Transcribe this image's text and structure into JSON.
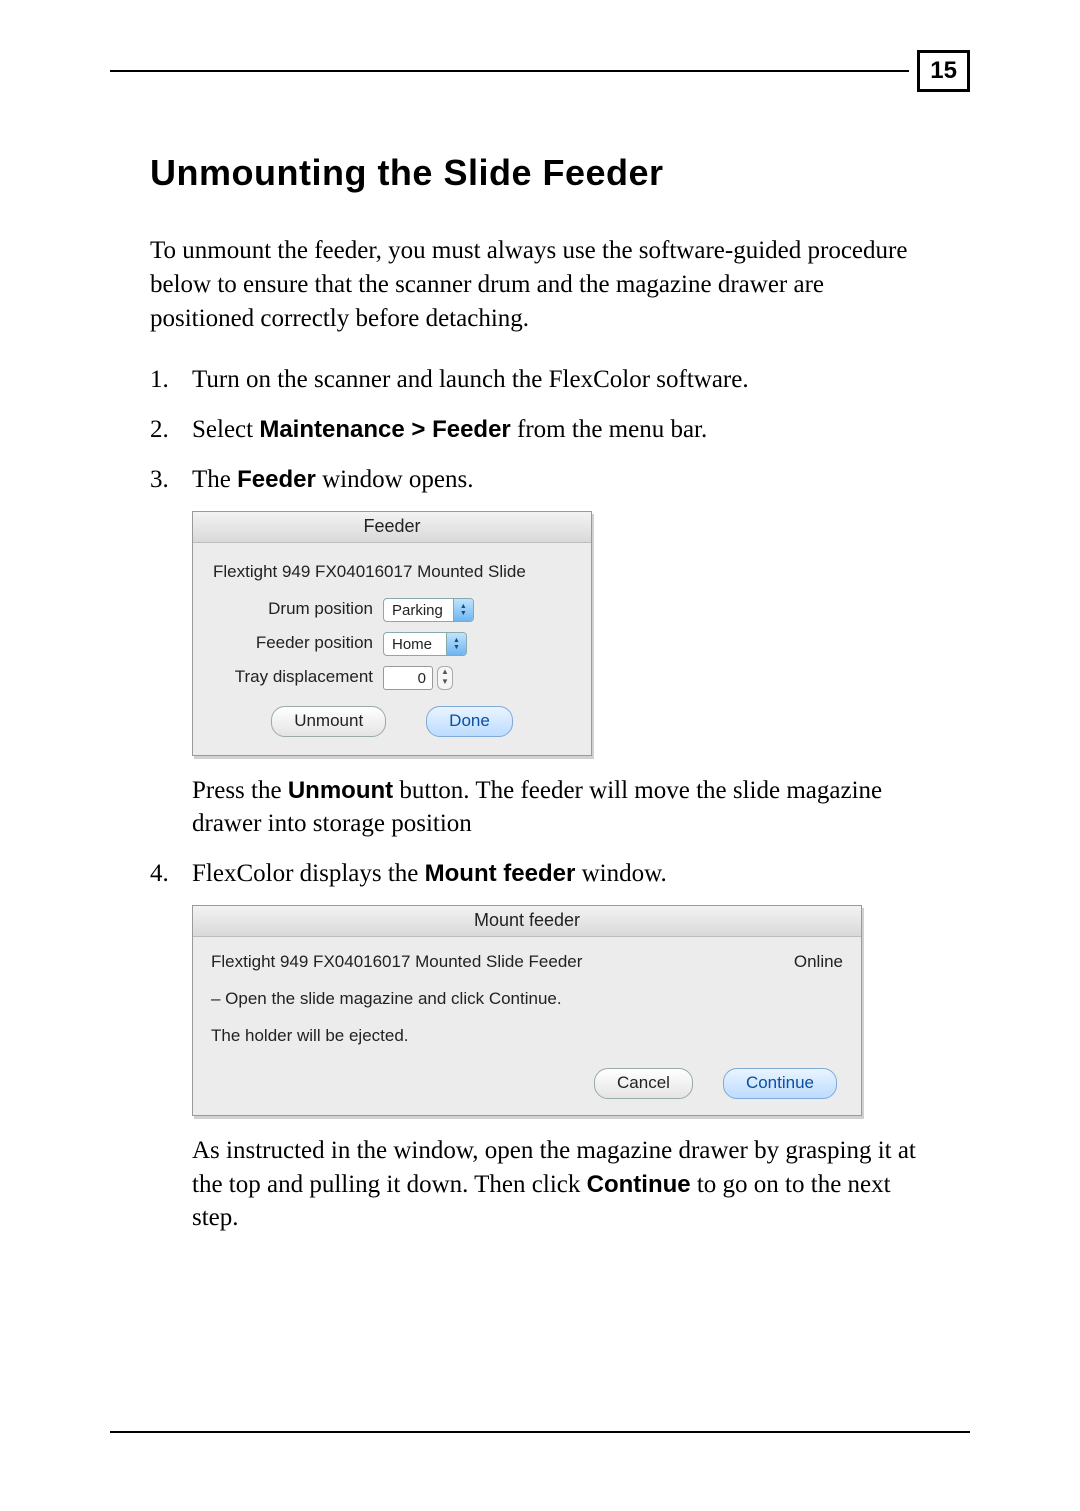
{
  "page_number": "15",
  "heading": "Unmounting the Slide Feeder",
  "intro": "To unmount the feeder, you must always use the software-guided procedure below to ensure that the scanner drum and the magazine drawer are positioned correctly before detaching.",
  "step1": "Turn on the scanner and launch the FlexColor software.",
  "step2_a": "Select ",
  "step2_bold": "Maintenance > Feeder",
  "step2_b": " from the menu bar.",
  "step3_a": "The ",
  "step3_bold": "Feeder",
  "step3_b": " window opens.",
  "feeder_dialog": {
    "title": "Feeder",
    "device": "Flextight 949 FX04016017 Mounted Slide",
    "drum_label": "Drum position",
    "drum_value": "Parking",
    "feeder_label": "Feeder position",
    "feeder_value": "Home",
    "tray_label": "Tray displacement",
    "tray_value": "0",
    "btn_unmount": "Unmount",
    "btn_done": "Done"
  },
  "step3_after_a": "Press the ",
  "step3_after_bold": "Unmount",
  "step3_after_b": " button. The feeder will move the slide magazine drawer into storage position",
  "step4_a": "FlexColor displays the ",
  "step4_bold": "Mount feeder",
  "step4_b": " window.",
  "mount_dialog": {
    "title": "Mount feeder",
    "device": "Flextight 949 FX04016017 Mounted Slide Feeder",
    "status": "Online",
    "line1": "– Open the slide magazine and click Continue.",
    "line2": "The holder will be ejected.",
    "btn_cancel": "Cancel",
    "btn_continue": "Continue"
  },
  "step4_after_a": "As instructed in the window, open the magazine drawer by grasping it at the top and pulling it down. Then click ",
  "step4_after_bold": "Continue",
  "step4_after_b": " to go on to the next step."
}
